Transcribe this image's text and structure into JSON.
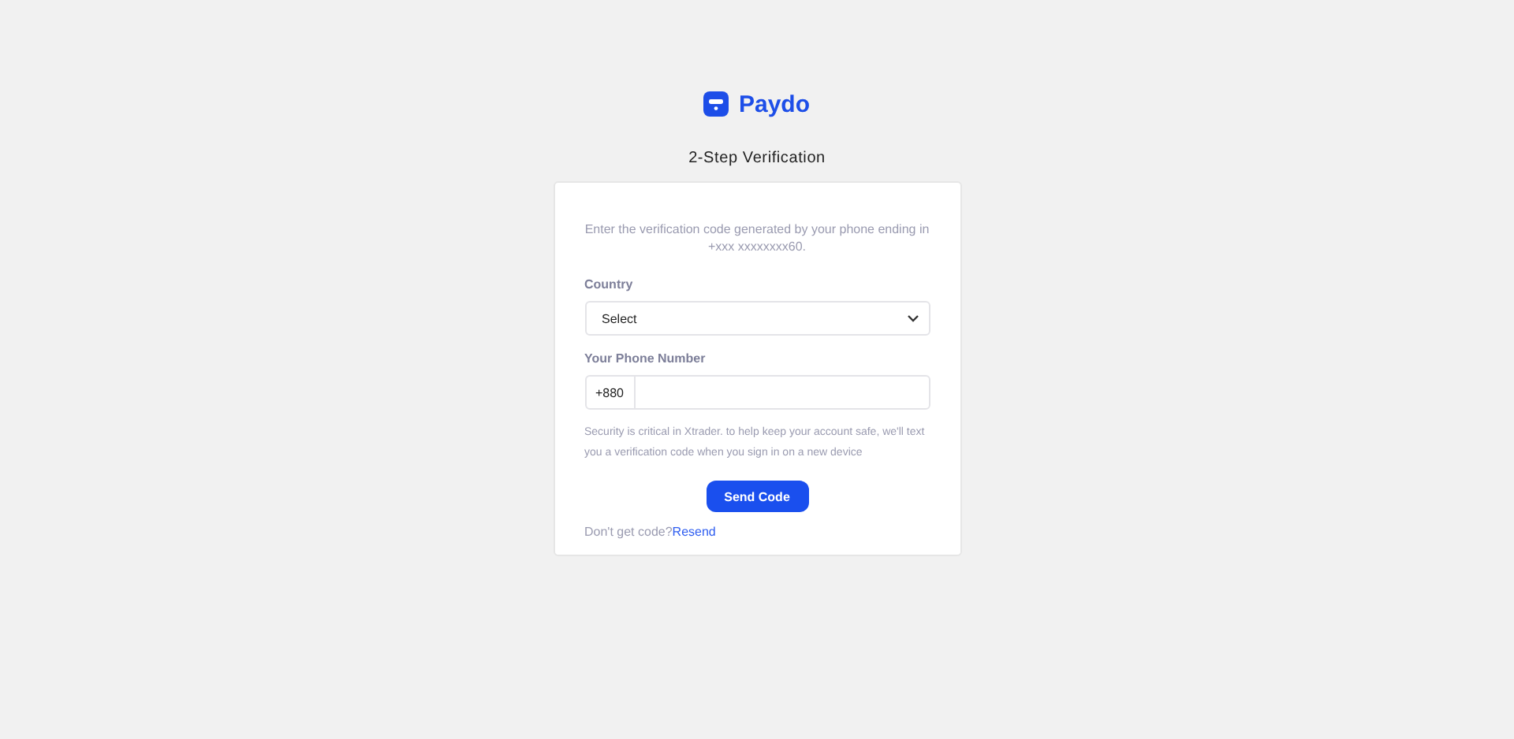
{
  "brand": {
    "name": "Paydo"
  },
  "title": "2-Step Verification",
  "intro": "Enter the verification code generated by your phone ending in +xxx xxxxxxxx60.",
  "country": {
    "label": "Country",
    "value": "Select"
  },
  "phone": {
    "label": "Your Phone Number",
    "prefix": "+880"
  },
  "note": "Security is critical in Xtrader. to help keep your account safe, we'll text you a verification code when you sign in on a new device",
  "button": "Send Code",
  "resend": {
    "text": "Don't get code?",
    "link": "Resend"
  }
}
